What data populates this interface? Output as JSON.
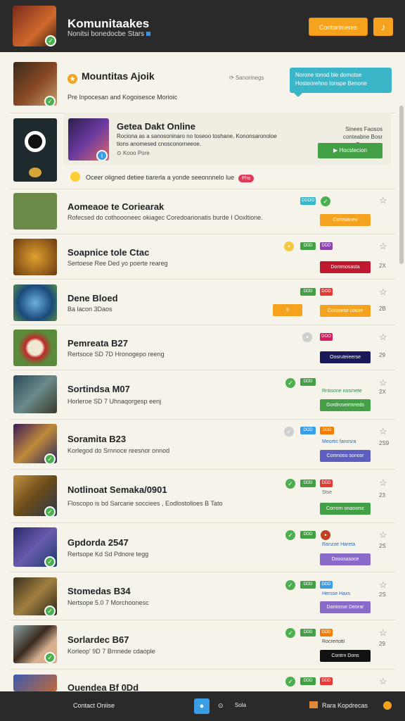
{
  "header": {
    "title": "Komunitaakes",
    "subtitle": "Nonitsi bonedocbe Stars",
    "button_label": "Contorimeres",
    "icon": "bell-icon"
  },
  "featured": {
    "title": "Mountitas Ajoik",
    "sync_text": "Sanorinegs",
    "bubble_text": "Norone tonod ble domotse Hosteorehno Ionspe Benone",
    "subtitle": "Pre Inpocesan and Kogoisesce Morioic",
    "card": {
      "title": "Getea Dakt Online",
      "desc": "Rociona as a sanosoninaro no toseoo toshane, Kononsaronoloe tions anomesed cnosconorneeoe.",
      "meta": "Kooo Pore",
      "right_text": "Sinees Faosos conteabne Bosr Perconsse",
      "button": "Hocstecion"
    },
    "invite_text": "Oceer oligned detiee tiarerla a yonde seeonnnelo lue",
    "invite_pill": "Phs"
  },
  "rows": [
    {
      "name": "Aomeaoe te Coriearak",
      "desc": "Rofecsed do cothoooneec okiagec Coredoarionatis burde I Ooxltione.",
      "tag1": "DDOO",
      "tag2": "",
      "button": "Comsianeo",
      "star_count": ""
    },
    {
      "name": "Soapnice tole Ctac",
      "desc": "Sertoese Ree Ded yo poerte reareg",
      "tag1": "DDD",
      "tag2": "DDD",
      "button": "Dommosasta",
      "star_count": "2X"
    },
    {
      "name": "Dene Bloed",
      "desc": "Ba lacon 3Daos",
      "tag1": "DDD",
      "tag2": "DOD",
      "button": "Cotuoese cosne",
      "star_count": "2B"
    },
    {
      "name": "Pemreata B27",
      "desc": "Rertsoce SD 7D Hronogepo reeng",
      "tag1": "",
      "tag2": "DOO",
      "button": "Oosruteieerse",
      "star_count": "29"
    },
    {
      "name": "Sortindsa M07",
      "desc": "Horleroe SD 7 Uhnaqorgesp eenj",
      "tag1": "DDD",
      "tag2": "",
      "link": "Rntisone nosrnete",
      "button": "Gordroseimmeds",
      "star_count": "2X"
    },
    {
      "name": "Soramita B23",
      "desc": "Korlegod do Srnnoce reesnor onnod",
      "tag1": "DOD",
      "tag2": "DDD",
      "link": "Meortic fanosra",
      "button": "Comnoso sonosr",
      "star_count": "2S9"
    },
    {
      "name": "Notlinoat Semaka/0901",
      "desc": "Floscopo is bd Sarcarie socciees , Eodlostolloes B Tato",
      "tag1": "DDD",
      "tag2": "DDD",
      "link": "Stse",
      "button": "Corrorn onaosrsc",
      "star_count": "23"
    },
    {
      "name": "Gpdorda 2547",
      "desc": "Rertsope Kd Sd Pdnore tegg",
      "tag1": "DDD",
      "tag2": "",
      "link": "Ranzoe Hareta",
      "button": "Dooosasoce",
      "star_count": "2S"
    },
    {
      "name": "Stomedas B34",
      "desc": "Nertsope 5.0 7 Morchoonesc",
      "tag1": "DDD",
      "tag2": "DDD",
      "link": "Hersse Haxs",
      "button": "Dantosse Deorar",
      "star_count": "2S"
    },
    {
      "name": "Sorlardec B67",
      "desc": "Korleop' 9D 7 Brnnede cdaople",
      "tag1": "DDD",
      "tag2": "DDD",
      "link": "Rocrertotti",
      "button": "Contrn Dons",
      "star_count": "29"
    },
    {
      "name": "Ouendea Bf 0Dd",
      "desc": "",
      "tag1": "DDD",
      "tag2": "DDD",
      "link": "",
      "button": "",
      "star_count": ""
    }
  ],
  "bottom": {
    "left": "Contact Oniise",
    "chat_icon": "chat-bubble-icon",
    "mid": "Sola",
    "right": "Rara Kopdrecas"
  },
  "colors": {
    "accent": "#f5a21e",
    "green": "#43a047",
    "teal": "#3bb6c8",
    "header_bg": "#2a2a2a"
  }
}
